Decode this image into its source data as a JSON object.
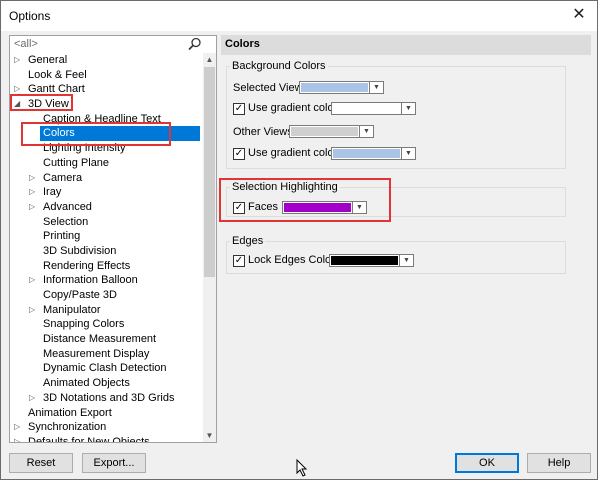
{
  "window": {
    "title": "Options",
    "close": "✕"
  },
  "search": {
    "placeholder": "<all>"
  },
  "tree": [
    {
      "label": "General",
      "level": 0,
      "arrow": "▷"
    },
    {
      "label": "Look & Feel",
      "level": 0,
      "arrow": ""
    },
    {
      "label": "Gantt Chart",
      "level": 0,
      "arrow": "▷"
    },
    {
      "label": "3D View",
      "level": 0,
      "arrow": "◢"
    },
    {
      "label": "Caption & Headline Text",
      "level": 1,
      "arrow": ""
    },
    {
      "label": "Colors",
      "level": 1,
      "arrow": "▷",
      "selected": true
    },
    {
      "label": "Lighting Intensity",
      "level": 1,
      "arrow": ""
    },
    {
      "label": "Cutting Plane",
      "level": 1,
      "arrow": ""
    },
    {
      "label": "Camera",
      "level": 1,
      "arrow": "▷"
    },
    {
      "label": "Iray",
      "level": 1,
      "arrow": "▷"
    },
    {
      "label": "Advanced",
      "level": 1,
      "arrow": "▷"
    },
    {
      "label": "Selection",
      "level": 1,
      "arrow": ""
    },
    {
      "label": "Printing",
      "level": 1,
      "arrow": ""
    },
    {
      "label": "3D Subdivision",
      "level": 1,
      "arrow": ""
    },
    {
      "label": "Rendering Effects",
      "level": 1,
      "arrow": ""
    },
    {
      "label": "Information Balloon",
      "level": 1,
      "arrow": "▷"
    },
    {
      "label": "Copy/Paste 3D",
      "level": 1,
      "arrow": ""
    },
    {
      "label": "Manipulator",
      "level": 1,
      "arrow": "▷"
    },
    {
      "label": "Snapping Colors",
      "level": 1,
      "arrow": ""
    },
    {
      "label": "Distance Measurement",
      "level": 1,
      "arrow": ""
    },
    {
      "label": "Measurement Display",
      "level": 1,
      "arrow": ""
    },
    {
      "label": "Dynamic Clash Detection",
      "level": 1,
      "arrow": ""
    },
    {
      "label": "Animated Objects",
      "level": 1,
      "arrow": ""
    },
    {
      "label": "3D Notations and 3D Grids",
      "level": 1,
      "arrow": "▷"
    },
    {
      "label": "Animation Export",
      "level": 0,
      "arrow": ""
    },
    {
      "label": "Synchronization",
      "level": 0,
      "arrow": "▷"
    },
    {
      "label": "Defaults for New Objects",
      "level": 0,
      "arrow": "▷"
    }
  ],
  "panel": {
    "title": "Colors",
    "background_group": {
      "title": "Background Colors",
      "selected_view_label": "Selected View",
      "selected_view_color": "#a9c4e4",
      "gradient1_label": "Use gradient color",
      "gradient1_checked": "✓",
      "gradient1_color": "#ffffff",
      "other_views_label": "Other Views",
      "other_views_color": "#cfcfcf",
      "gradient2_label": "Use gradient color",
      "gradient2_checked": "✓",
      "gradient2_color": "#a9c4e4"
    },
    "selection_group": {
      "title": "Selection Highlighting",
      "faces_label": "Faces",
      "faces_checked": "✓",
      "faces_color": "#a000c8"
    },
    "edges_group": {
      "title": "Edges",
      "lock_label": "Lock Edges Color",
      "lock_checked": "✓",
      "lock_color": "#000000"
    }
  },
  "buttons": {
    "reset": "Reset",
    "export": "Export...",
    "ok": "OK",
    "help": "Help"
  },
  "colors": {
    "selection": "#0078d7",
    "highlight": "#e03535"
  }
}
